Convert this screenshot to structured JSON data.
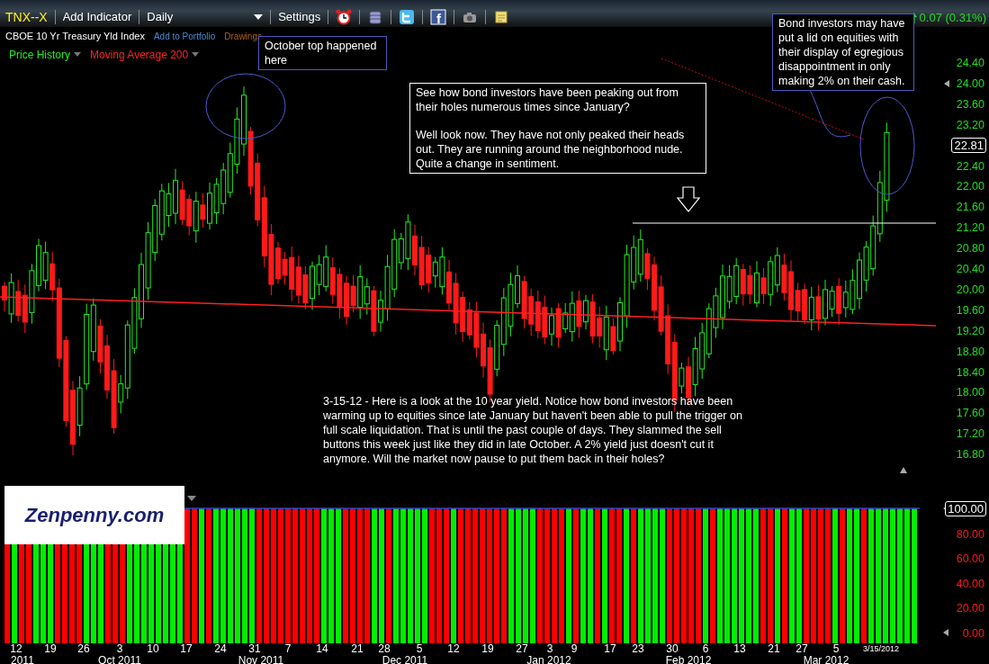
{
  "toolbar": {
    "symbol": "TNX--X",
    "items": [
      {
        "kind": "button",
        "label": "Add Indicator"
      },
      {
        "kind": "dropdown",
        "label": "Daily"
      },
      {
        "kind": "button",
        "label": "Settings"
      }
    ],
    "icons": [
      {
        "kind": "alarm"
      },
      {
        "kind": "database"
      },
      {
        "kind": "bird"
      },
      {
        "kind": "social",
        "glyph": "f"
      },
      {
        "kind": "camera"
      },
      {
        "kind": "note"
      }
    ],
    "change": "0.07 (0.31%)"
  },
  "subtitle": {
    "name": "CBOE 10 Yr Treasury Yld Index",
    "links": [
      "Add to Portfolio",
      "Drawings"
    ]
  },
  "overlays": [
    {
      "label": "Price History",
      "color": "#22ee22"
    },
    {
      "label": "Moving Average 200",
      "color": "#ff2222"
    }
  ],
  "annotations": [
    {
      "kind": "boxed",
      "paragraphs": [
        "October top happened here"
      ]
    },
    {
      "kind": "boxed-white",
      "paragraphs": [
        "See how bond investors have been peaking out from their holes numerous times since January?",
        "Well look now. They have not only peaked their heads out. They are running around the neighborhood nude. Quite a change in sentiment."
      ]
    },
    {
      "kind": "boxed",
      "paragraphs": [
        "Bond investors may have put a lid on equities with their display of egregious disappointment in only making 2% on their cash."
      ]
    },
    {
      "kind": "plain",
      "paragraphs": [
        "3-15-12 - Here is a look at the 10 year yield. Notice how bond investors have been warming up to equities since late January but haven't been able to pull the trigger on full scale liquidation. That is until the past couple of days. They slammed the sell buttons this week just like they did in late October. A 2% yield just doesn't cut it anymore. Will the market now pause to put them back in their holes?"
      ]
    }
  ],
  "price_axis": [
    "24.40",
    "24.00",
    "23.60",
    "23.20",
    "22.81",
    "22.40",
    "22.00",
    "21.60",
    "21.20",
    "20.80",
    "20.40",
    "20.00",
    "19.60",
    "19.20",
    "18.80",
    "18.40",
    "18.00",
    "17.60",
    "17.20",
    "16.80"
  ],
  "logo": "Zenpenny.com",
  "lower_axis": [
    "100.00",
    "80.00",
    "60.00",
    "40.00",
    "20.00",
    "0.00"
  ],
  "x_days": [
    "12",
    "19",
    "26",
    "3",
    "10",
    "17",
    "24",
    "31",
    "7",
    "14",
    "21",
    "28",
    "5",
    "12",
    "19",
    "27",
    "3",
    "9",
    "17",
    "23",
    "30",
    "6",
    "13",
    "21",
    "27",
    "5"
  ],
  "x_months": [
    "2011",
    "Oct 2011",
    "Nov 2011",
    "Dec 2011",
    "Jan 2012",
    "Feb 2012",
    "Mar 2012"
  ],
  "x_date": "3/15/2012"
}
